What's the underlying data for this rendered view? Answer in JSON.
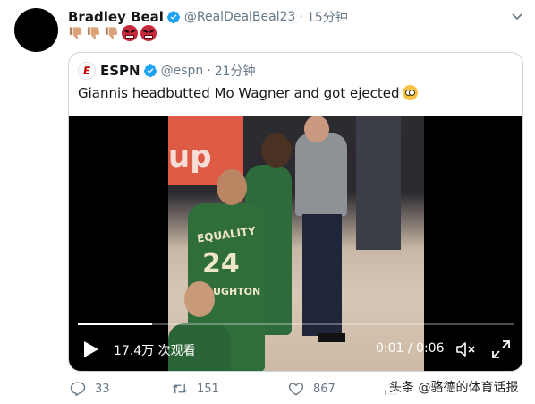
{
  "tweet": {
    "author_name": "Bradley Beal",
    "author_handle": "@RealDealBeal23",
    "separator": "·",
    "time": "15分钟",
    "emojis": [
      "thumbs-down-light",
      "thumbs-down-light",
      "thumbs-down-light",
      "angry-face",
      "angry-face"
    ]
  },
  "quoted": {
    "author_name": "ESPN",
    "logo_text": "E",
    "author_handle": "@espn",
    "separator": "·",
    "time": "21分钟",
    "text": "Giannis headbutted Mo Wagner and got ejected",
    "trailing_emoji": "flushed-face",
    "video": {
      "banner_text": "up",
      "jersey_top_text": "EQUALITY",
      "jersey_number": "24",
      "jersey_bottom_text": "UGHTON",
      "progress": 0.17,
      "views": "17.4万 次观看",
      "timecode": "0:01 / 0:06"
    }
  },
  "actions": {
    "reply_count": "33",
    "retweet_count": "151",
    "like_count": "867"
  },
  "watermark": "头条 @骆德的体育话报",
  "colors": {
    "verified_blue": "#1da1f2",
    "secondary_text": "#657786",
    "espn_red": "#cc0000"
  },
  "icons": [
    "verified-badge-icon",
    "chevron-down-icon",
    "play-icon",
    "volume-muted-icon",
    "fullscreen-icon",
    "reply-icon",
    "retweet-icon",
    "like-icon",
    "share-icon"
  ]
}
